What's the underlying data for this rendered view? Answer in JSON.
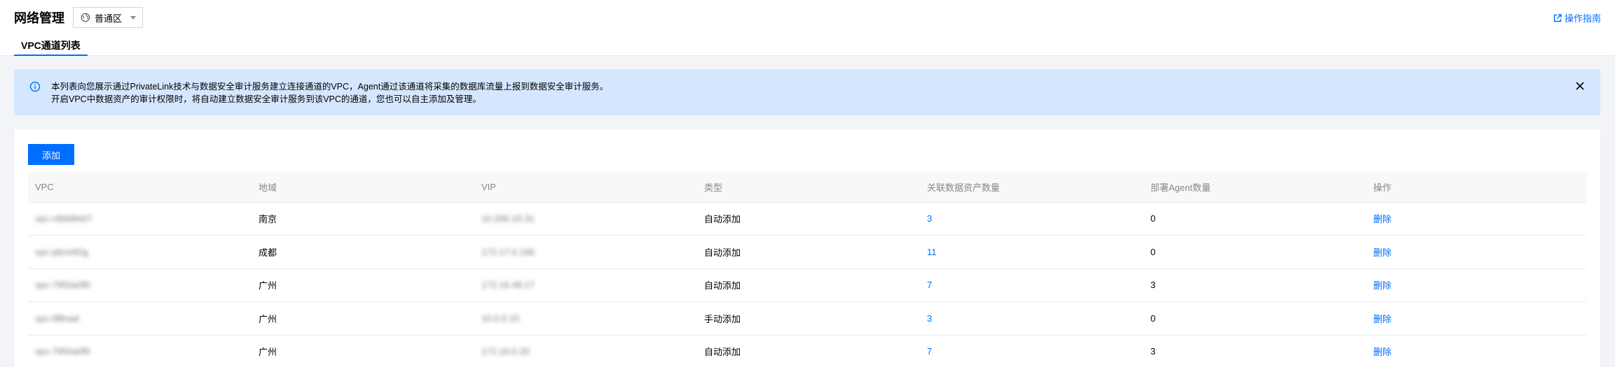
{
  "header": {
    "title": "网络管理",
    "region": "普通区",
    "guide_link": "操作指南",
    "tab": "VPC通道列表"
  },
  "notice": {
    "line1": "本列表向您展示通过PrivateLink技术与数据安全审计服务建立连接通道的VPC，Agent通过该通道将采集的数据库流量上报到数据安全审计服务。",
    "line2": "开启VPC中数据资产的审计权限时，将自动建立数据安全审计服务到该VPC的通道，您也可以自主添加及管理。"
  },
  "toolbar": {
    "add_label": "添加"
  },
  "table": {
    "columns": [
      "VPC",
      "地域",
      "VIP",
      "类型",
      "关联数据资产数量",
      "部署Agent数量",
      "操作"
    ],
    "rows": [
      {
        "vpc": "vpc-c6bb8eb7",
        "region": "南京",
        "vip": "10.206.10.31",
        "type": "自动添加",
        "assets": "3",
        "agents": "0",
        "action": "删除"
      },
      {
        "vpc": "vpc-pbrsr82g",
        "region": "成都",
        "vip": "172.17.0.166",
        "type": "自动添加",
        "assets": "11",
        "agents": "0",
        "action": "删除"
      },
      {
        "vpc": "vpc-7950a0f0",
        "region": "广州",
        "vip": "172.16.48.17",
        "type": "自动添加",
        "assets": "7",
        "agents": "3",
        "action": "删除"
      },
      {
        "vpc": "vpc-i8finad",
        "region": "广州",
        "vip": "10.0.0.15",
        "type": "手动添加",
        "assets": "3",
        "agents": "0",
        "action": "删除"
      },
      {
        "vpc": "vpc-7950a0f0",
        "region": "广州",
        "vip": "172.16.0.20",
        "type": "自动添加",
        "assets": "7",
        "agents": "3",
        "action": "删除"
      }
    ]
  },
  "colors": {
    "accent": "#006eff",
    "notice_bg": "#d5e7ff"
  },
  "icons": {
    "region": "globe-icon",
    "guide": "external-link-icon",
    "notice": "info-icon",
    "close": "close-icon"
  }
}
